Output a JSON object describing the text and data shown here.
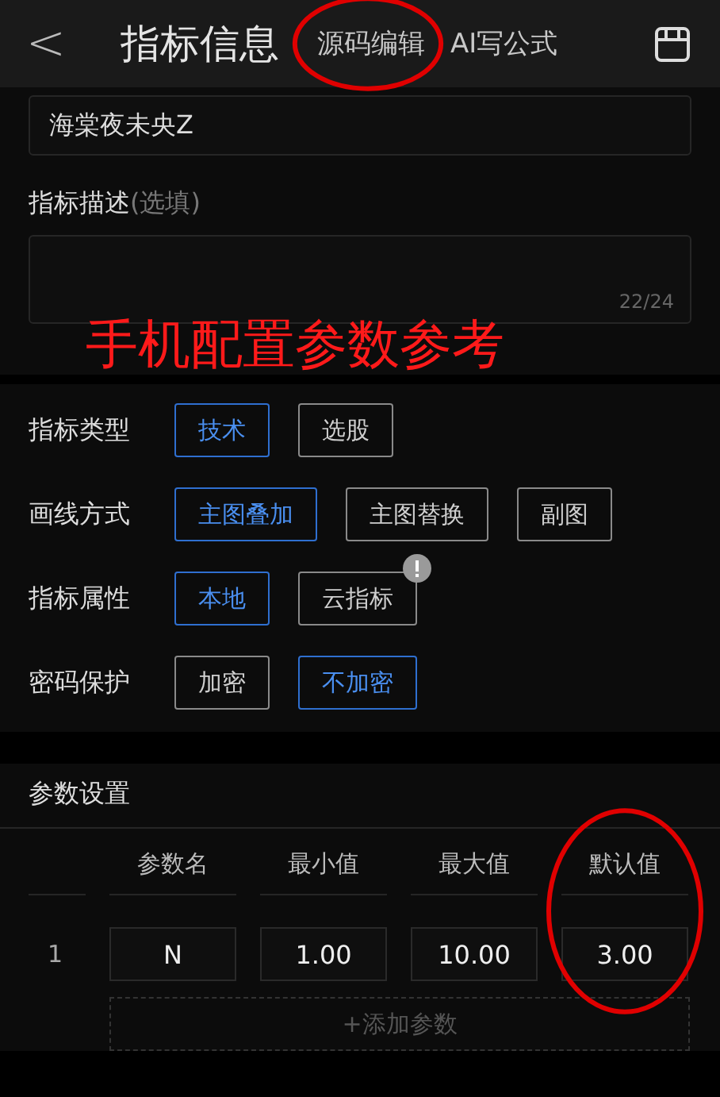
{
  "header": {
    "back": "<",
    "title": "指标信息",
    "tabs": [
      {
        "label": "源码编辑",
        "highlighted": true
      },
      {
        "label": "AI写公式",
        "highlighted": false
      }
    ]
  },
  "name_field": {
    "value": "海棠夜未央Z"
  },
  "description": {
    "label": "指标描述",
    "hint": "(选填)",
    "counter": "22/24"
  },
  "annotation_text": "手机配置参数参考",
  "options": [
    {
      "label": "指标类型",
      "choices": [
        {
          "label": "技术",
          "selected": true,
          "badge": false
        },
        {
          "label": "选股",
          "selected": false,
          "badge": false
        }
      ]
    },
    {
      "label": "画线方式",
      "choices": [
        {
          "label": "主图叠加",
          "selected": true,
          "badge": false
        },
        {
          "label": "主图替换",
          "selected": false,
          "badge": false
        },
        {
          "label": "副图",
          "selected": false,
          "badge": false
        }
      ]
    },
    {
      "label": "指标属性",
      "choices": [
        {
          "label": "本地",
          "selected": true,
          "badge": false
        },
        {
          "label": "云指标",
          "selected": false,
          "badge": true
        }
      ]
    },
    {
      "label": "密码保护",
      "choices": [
        {
          "label": "加密",
          "selected": false,
          "badge": false
        },
        {
          "label": "不加密",
          "selected": true,
          "badge": false
        }
      ]
    }
  ],
  "params": {
    "title": "参数设置",
    "columns": [
      {
        "label": "参数名",
        "highlighted": false
      },
      {
        "label": "最小值",
        "highlighted": false
      },
      {
        "label": "最大值",
        "highlighted": false
      },
      {
        "label": "默认值",
        "highlighted": true
      }
    ],
    "rows": [
      {
        "index": "1",
        "cells": [
          "N",
          "1.00",
          "10.00",
          "3.00"
        ]
      }
    ],
    "add_button": "+添加参数"
  }
}
